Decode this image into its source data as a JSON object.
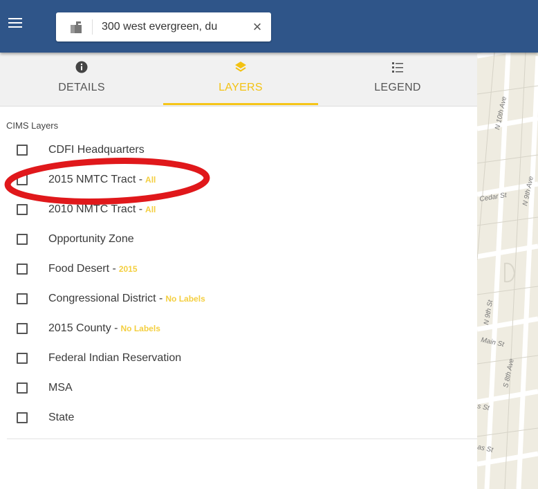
{
  "header": {
    "search": {
      "value": "300 west evergreen, du",
      "placeholder": ""
    }
  },
  "tabs": [
    {
      "label": "DETAILS",
      "icon": "info-icon",
      "active": false
    },
    {
      "label": "LAYERS",
      "icon": "layers-icon",
      "active": true
    },
    {
      "label": "LEGEND",
      "icon": "legend-icon",
      "active": false
    }
  ],
  "layers_panel": {
    "section_title": "CIMS Layers",
    "items": [
      {
        "label": "CDFI Headquarters",
        "tag": "",
        "checked": false
      },
      {
        "label": "2015 NMTC Tract -",
        "tag": "All",
        "checked": false
      },
      {
        "label": "2010 NMTC Tract -",
        "tag": "All",
        "checked": false
      },
      {
        "label": "Opportunity Zone",
        "tag": "",
        "checked": false
      },
      {
        "label": "Food Desert -",
        "tag": "2015",
        "checked": false
      },
      {
        "label": "Congressional District -",
        "tag": "No Labels",
        "checked": false
      },
      {
        "label": "2015 County -",
        "tag": "No Labels",
        "checked": false
      },
      {
        "label": "Federal Indian Reservation",
        "tag": "",
        "checked": false
      },
      {
        "label": "MSA",
        "tag": "",
        "checked": false
      },
      {
        "label": "State",
        "tag": "",
        "checked": false
      }
    ]
  },
  "map": {
    "street_labels": [
      "N 10th Ave",
      "N 9th Ave",
      "Cedar St",
      "N 9th St",
      "Main St",
      "S 8th Ave",
      "s St",
      "as St"
    ]
  },
  "colors": {
    "header": "#2f5589",
    "accent": "#f5c518",
    "tag": "#f4cf40",
    "annotation": "#e0181b",
    "map_bg": "#efece1"
  }
}
